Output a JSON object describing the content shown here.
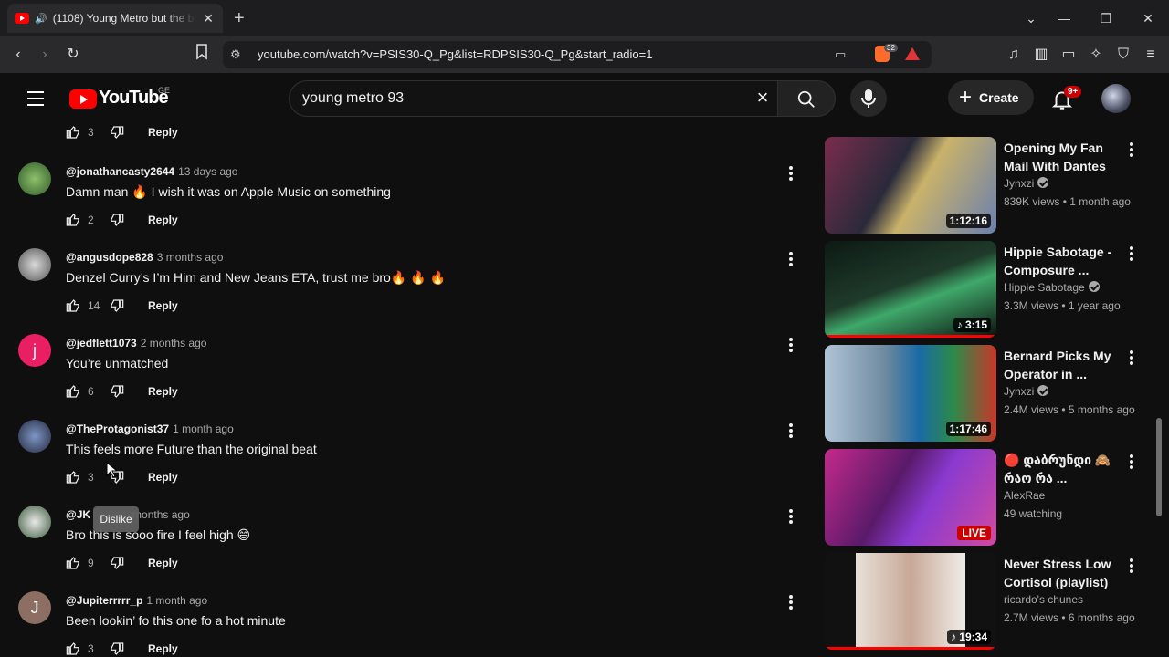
{
  "browser": {
    "tab_title": "(1108) Young Metro but the b",
    "url": "youtube.com/watch?v=PSIS30-Q_Pg&list=RDPSIS30-Q_Pg&start_radio=1",
    "brave_badge": "32"
  },
  "header": {
    "logo": "YouTube",
    "country": "GE",
    "search_query": "young metro 93",
    "create_label": "Create",
    "notif_badge": "9+"
  },
  "top_row": {
    "likes": "3",
    "reply": "Reply"
  },
  "comments": [
    {
      "author": "@jonathancasty2644",
      "time": "13 days ago",
      "text": "Damn man 🔥 I wish it was on Apple Music on something",
      "likes": "2",
      "reply": "Reply"
    },
    {
      "author": "@angusdope828",
      "time": "3 months ago",
      "text": "Denzel Curry’s I’m Him and New Jeans ETA, trust me bro🔥 🔥 🔥",
      "likes": "14",
      "reply": "Reply"
    },
    {
      "author": "@jedflett1073",
      "time": "2 months ago",
      "text": "You’re unmatched",
      "likes": "6",
      "reply": "Reply",
      "initial": "j"
    },
    {
      "author": "@TheProtagonist37",
      "time": "1 month ago",
      "text": "This feels more Future than the original beat",
      "likes": "3",
      "reply": "Reply"
    },
    {
      "author": "@JK",
      "time": "months ago",
      "text": "Bro this is sooo fire I feel high 😄",
      "likes": "9",
      "reply": "Reply"
    },
    {
      "author": "@Jupiterrrrr_p",
      "time": "1 month ago",
      "text": "Been lookin’ fo this one fo a hot minute",
      "likes": "3",
      "reply": "Reply",
      "initial": "J"
    }
  ],
  "tooltip": "Dislike",
  "sidebar": [
    {
      "title": "Opening My Fan Mail With Dantes",
      "channel": "Jynxzi",
      "verified": true,
      "views": "839K views",
      "age": "1 month ago",
      "duration": "1:12:16"
    },
    {
      "title": "Hippie Sabotage - Composure ...",
      "channel": "Hippie Sabotage",
      "verified": true,
      "views": "3.3M views",
      "age": "1 year ago",
      "duration": "3:15"
    },
    {
      "title": "Bernard Picks My Operator in ...",
      "channel": "Jynxzi",
      "verified": true,
      "views": "2.4M views",
      "age": "5 months ago",
      "duration": "1:17:46"
    },
    {
      "title": "🔴 დაბრუნდი 🙈 რაო რა ...",
      "channel": "AlexRae",
      "verified": false,
      "views": "49 watching",
      "age": "",
      "duration": "LIVE"
    },
    {
      "title": "Never Stress Low Cortisol (playlist)",
      "channel": "ricardo's chunes",
      "verified": false,
      "views": "2.7M views",
      "age": "6 months ago",
      "duration": "19:34"
    }
  ],
  "colors": {
    "bg": "#0f0f0f",
    "accent_red": "#ff0000",
    "text": "#f1f1f1",
    "muted": "#aaaaaa"
  }
}
